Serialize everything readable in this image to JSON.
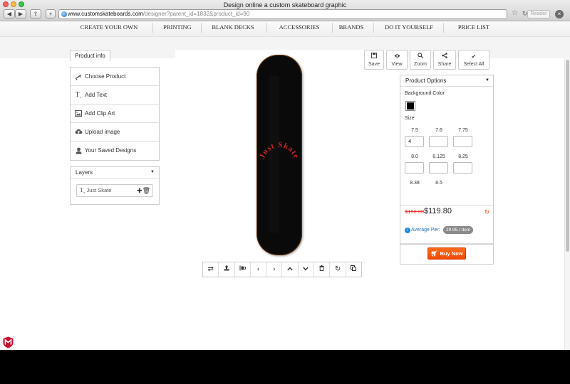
{
  "browser": {
    "window_title": "Design online a custom skateboard graphic",
    "url_host": "www.customskateboards.com",
    "url_path": "/designer?parent_id=1832&product_id=90",
    "reader_label": "Reader"
  },
  "main_nav": {
    "items": [
      "CREATE YOUR OWN",
      "PRINTING",
      "BLANK DECKS",
      "ACCESSORIES",
      "BRANDS",
      "DO IT YOURSELF",
      "PRICE LIST"
    ]
  },
  "left_panel": {
    "tab_label": "Product info",
    "menu": [
      {
        "label": "Choose Product",
        "icon": "skateboard-icon"
      },
      {
        "label": "Add Text",
        "icon": "text-icon"
      },
      {
        "label": "Add Clip Art",
        "icon": "image-icon"
      },
      {
        "label": "Upload image",
        "icon": "cloud-upload-icon"
      },
      {
        "label": "Your Saved Designs",
        "icon": "user-icon"
      }
    ],
    "layers_title": "Layers",
    "layer_item": "Just Skate"
  },
  "canvas": {
    "deck_text": "Just Skate",
    "deck_color": "#0a0a0a",
    "text_color": "#c62828"
  },
  "actions": [
    {
      "label": "Save",
      "icon": "save-icon"
    },
    {
      "label": "View",
      "icon": "eye-icon"
    },
    {
      "label": "Zoom",
      "icon": "search-icon"
    },
    {
      "label": "Share",
      "icon": "share-icon"
    },
    {
      "label": "Select All",
      "icon": "check-icon"
    }
  ],
  "toolbar": [
    "swap-icon",
    "stamp-icon",
    "align-icon",
    "arrow-left-icon",
    "arrow-right-icon",
    "arrow-up-icon",
    "arrow-down-icon",
    "trash-icon",
    "refresh-icon",
    "copy-icon"
  ],
  "options": {
    "title": "Product Options",
    "bg_color_label": "Background Color",
    "bg_color": "#000000",
    "size_label": "Size",
    "sizes": [
      {
        "label": "7.5",
        "qty": "4"
      },
      {
        "label": "7.6",
        "qty": ""
      },
      {
        "label": "7.75",
        "qty": ""
      },
      {
        "label": "8.0",
        "qty": ""
      },
      {
        "label": "8.125",
        "qty": ""
      },
      {
        "label": "8.25",
        "qty": ""
      },
      {
        "label": "8.38",
        "qty": ""
      },
      {
        "label": "8.5",
        "qty": ""
      }
    ],
    "old_price": "$150.00",
    "new_price": "$119.80",
    "avg_label": "Average Per:",
    "avg_value": "29.95 / Item",
    "buy_label": "Buy Now"
  },
  "colors": {
    "accent": "#f04a00",
    "price_strike": "#e53935",
    "link_blue": "#1e6fb5"
  }
}
